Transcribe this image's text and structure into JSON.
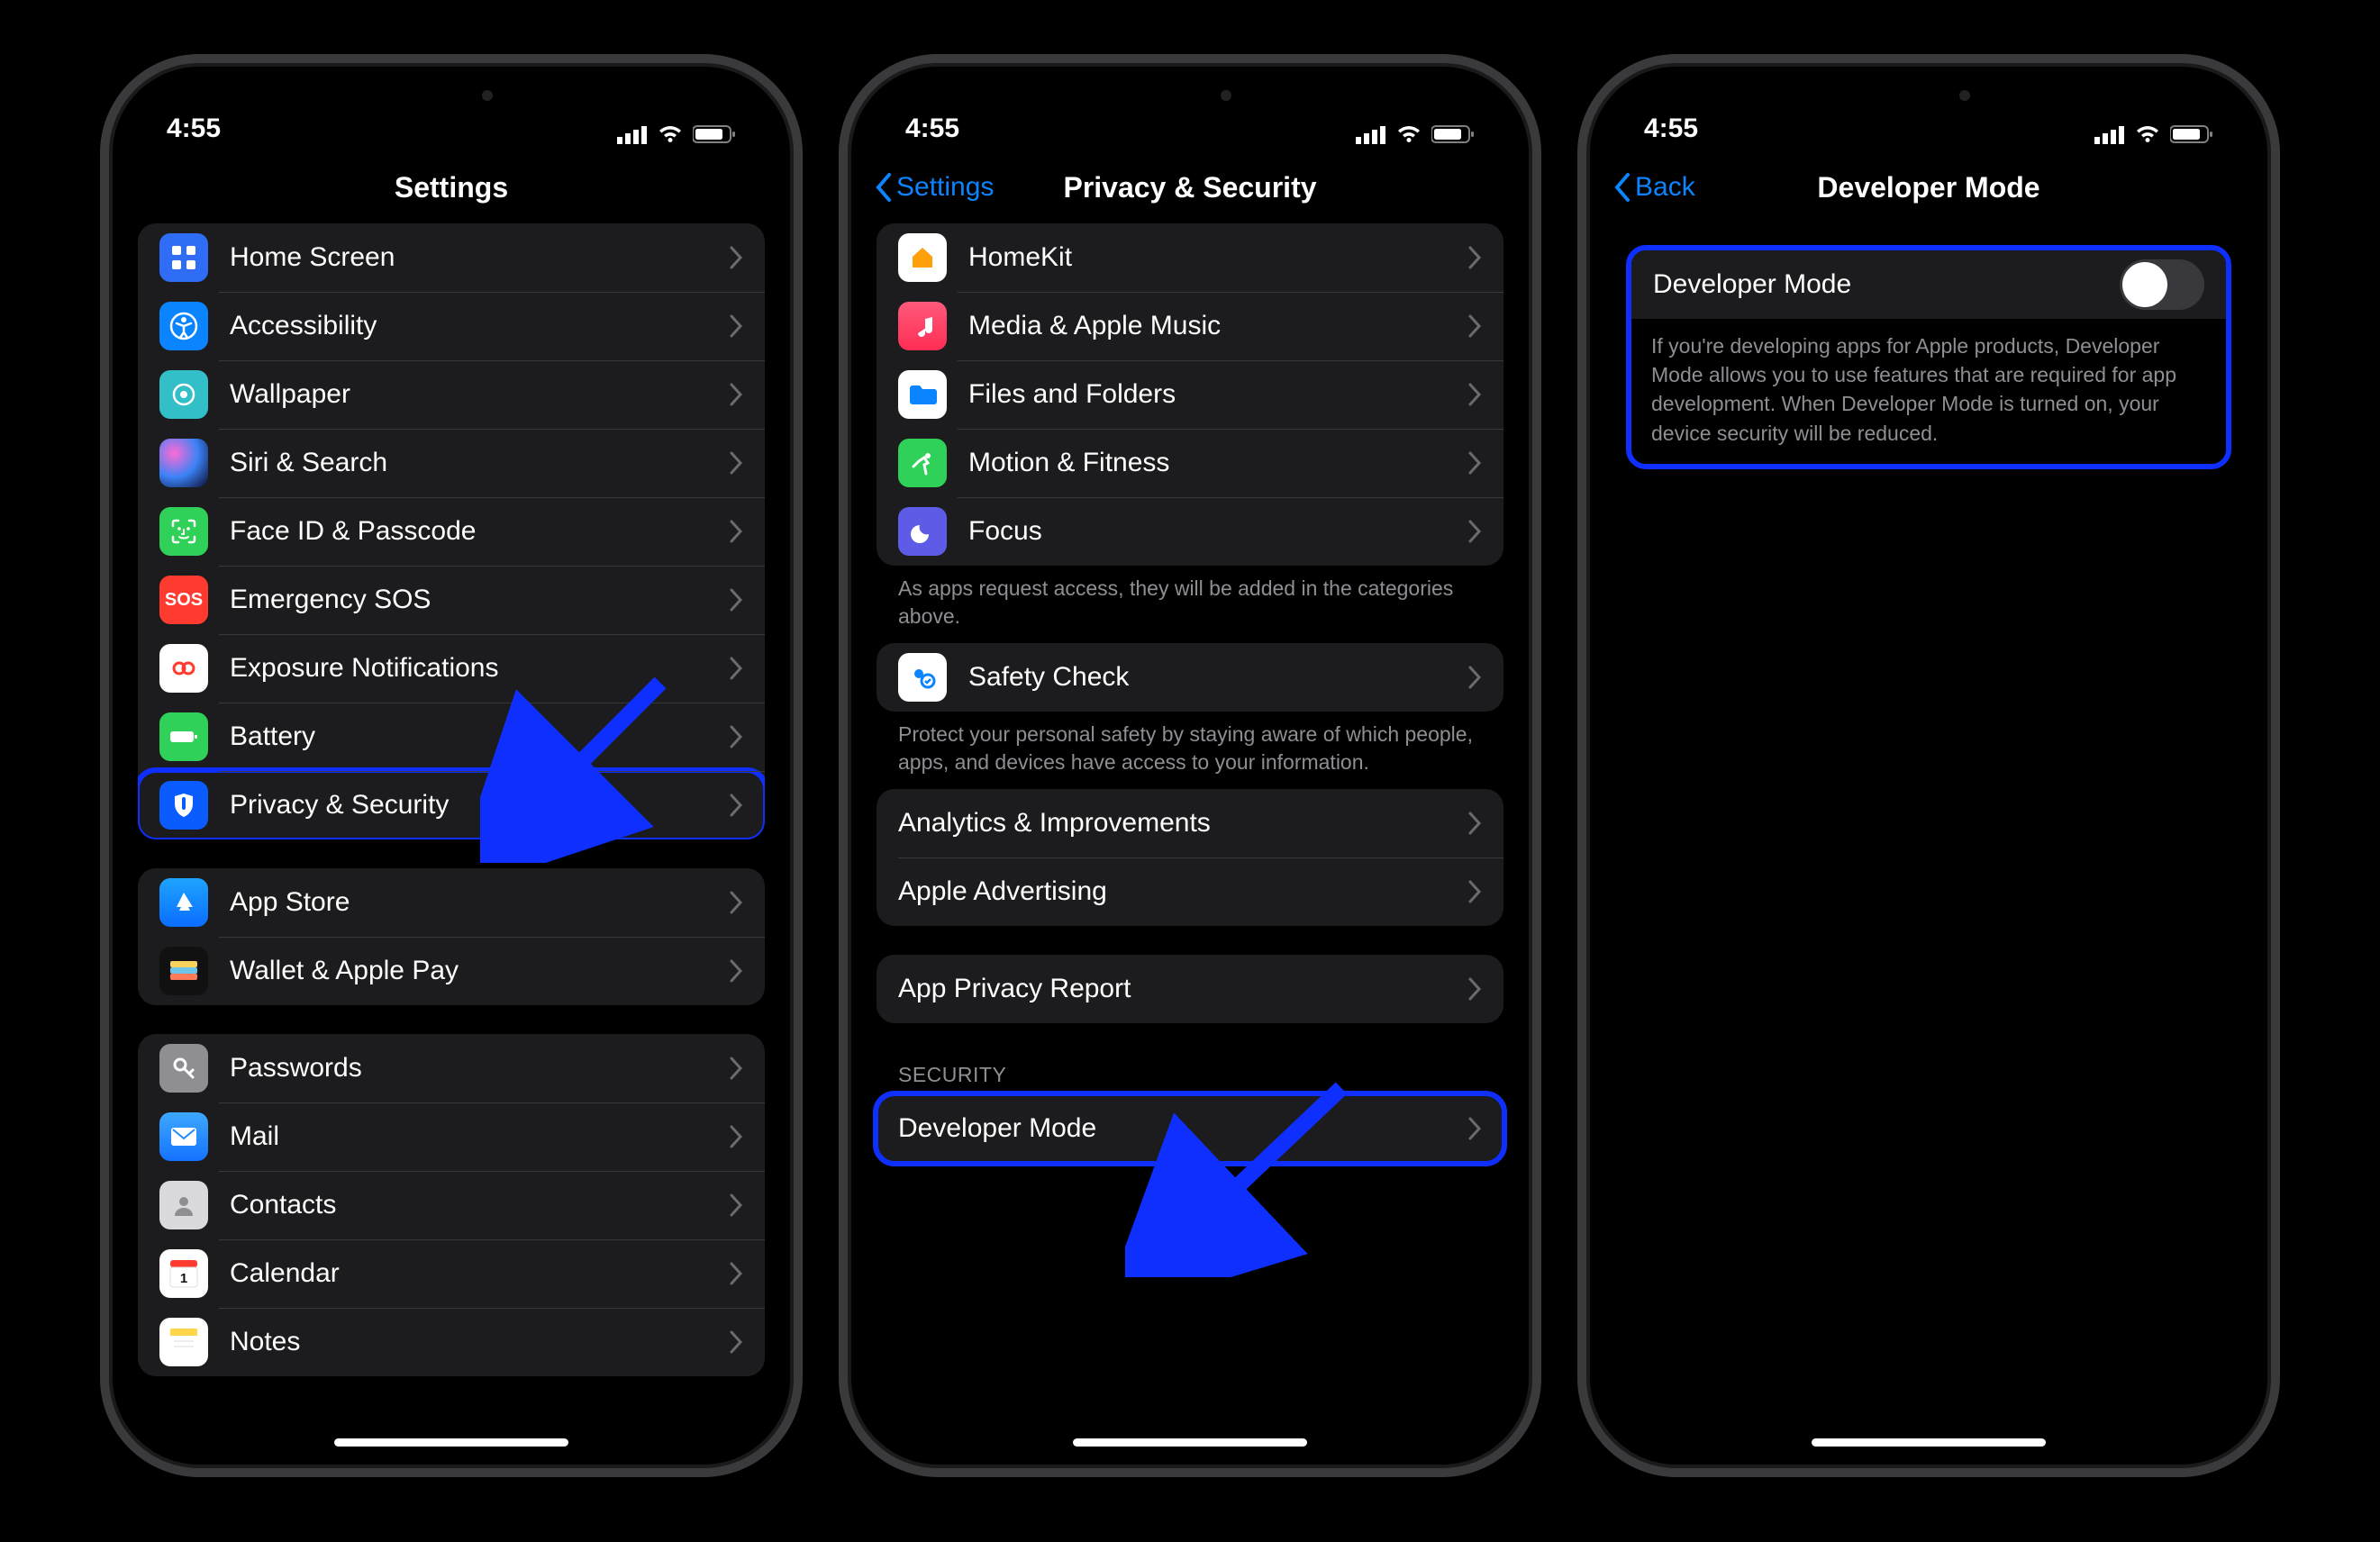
{
  "status": {
    "time": "4:55"
  },
  "phone1": {
    "title": "Settings",
    "items": [
      {
        "label": "Home Screen",
        "icon": "home-screen",
        "color": "#2f6df6"
      },
      {
        "label": "Accessibility",
        "icon": "accessibility",
        "color": "#0a84ff"
      },
      {
        "label": "Wallpaper",
        "icon": "wallpaper",
        "color": "#33bfc7"
      },
      {
        "label": "Siri & Search",
        "icon": "siri",
        "color": "#111"
      },
      {
        "label": "Face ID & Passcode",
        "icon": "faceid",
        "color": "#30d158"
      },
      {
        "label": "Emergency SOS",
        "icon": "sos",
        "color": "#ff3b30"
      },
      {
        "label": "Exposure Notifications",
        "icon": "exposure",
        "color": "#fff"
      },
      {
        "label": "Battery",
        "icon": "battery",
        "color": "#30d158"
      },
      {
        "label": "Privacy & Security",
        "icon": "privacy",
        "color": "#0a5cff",
        "highlight": true
      }
    ],
    "group2": [
      {
        "label": "App Store",
        "icon": "appstore",
        "color": "#0a84ff"
      },
      {
        "label": "Wallet & Apple Pay",
        "icon": "wallet",
        "color": "#111"
      }
    ],
    "group3": [
      {
        "label": "Passwords",
        "icon": "passwords",
        "color": "#8e8e93"
      },
      {
        "label": "Mail",
        "icon": "mail",
        "color": "#1e8cff"
      },
      {
        "label": "Contacts",
        "icon": "contacts",
        "color": "#bcbcc0"
      },
      {
        "label": "Calendar",
        "icon": "calendar",
        "color": "#fff"
      },
      {
        "label": "Notes",
        "icon": "notes",
        "color": "#fff"
      }
    ]
  },
  "phone2": {
    "back": "Settings",
    "title": "Privacy & Security",
    "groupA": [
      {
        "label": "HomeKit",
        "icon": "homekit",
        "color": "#ff9f0a"
      },
      {
        "label": "Media & Apple Music",
        "icon": "music",
        "color": "#ff2d55"
      },
      {
        "label": "Files and Folders",
        "icon": "files",
        "color": "#0a84ff"
      },
      {
        "label": "Motion & Fitness",
        "icon": "fitness",
        "color": "#30d158"
      },
      {
        "label": "Focus",
        "icon": "focus",
        "color": "#5e5ce6"
      }
    ],
    "footerA": "As apps request access, they will be added in the categories above.",
    "groupB": [
      {
        "label": "Safety Check",
        "icon": "safety",
        "color": "#fff"
      }
    ],
    "footerB": "Protect your personal safety by staying aware of which people, apps, and devices have access to your information.",
    "groupC": [
      {
        "label": "Analytics & Improvements"
      },
      {
        "label": "Apple Advertising"
      }
    ],
    "groupD": [
      {
        "label": "App Privacy Report"
      }
    ],
    "securityHeader": "SECURITY",
    "groupE": [
      {
        "label": "Developer Mode",
        "highlight": true
      }
    ]
  },
  "phone3": {
    "back": "Back",
    "title": "Developer Mode",
    "toggleLabel": "Developer Mode",
    "toggleOn": false,
    "footer": "If you're developing apps for Apple products, Developer Mode allows you to use features that are required for app development. When Developer Mode is turned on, your device security will be reduced."
  }
}
